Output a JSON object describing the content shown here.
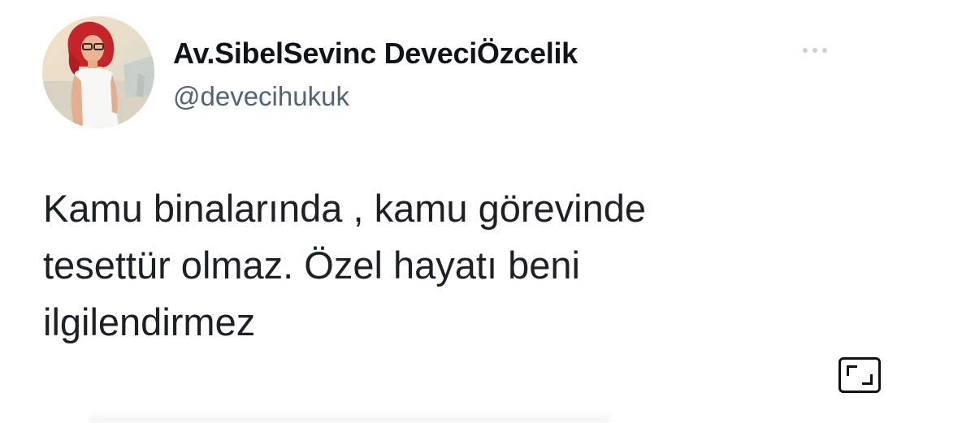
{
  "tweet": {
    "author": {
      "display_name": "Av.SibelSevinc DeveciÖzcelik",
      "handle": "@devecihukuk",
      "avatar_icon": "profile-photo"
    },
    "text": "Kamu binalarında , kamu görevinde\ntesettür olmaz. Özel hayatı beni\nilgilendirmez",
    "more_icon": "more-dots-icon",
    "expand_icon": "expand-icon"
  },
  "colors": {
    "name": "#0f1419",
    "handle": "#536471",
    "text": "#1c2126",
    "background": "#ffffff"
  }
}
